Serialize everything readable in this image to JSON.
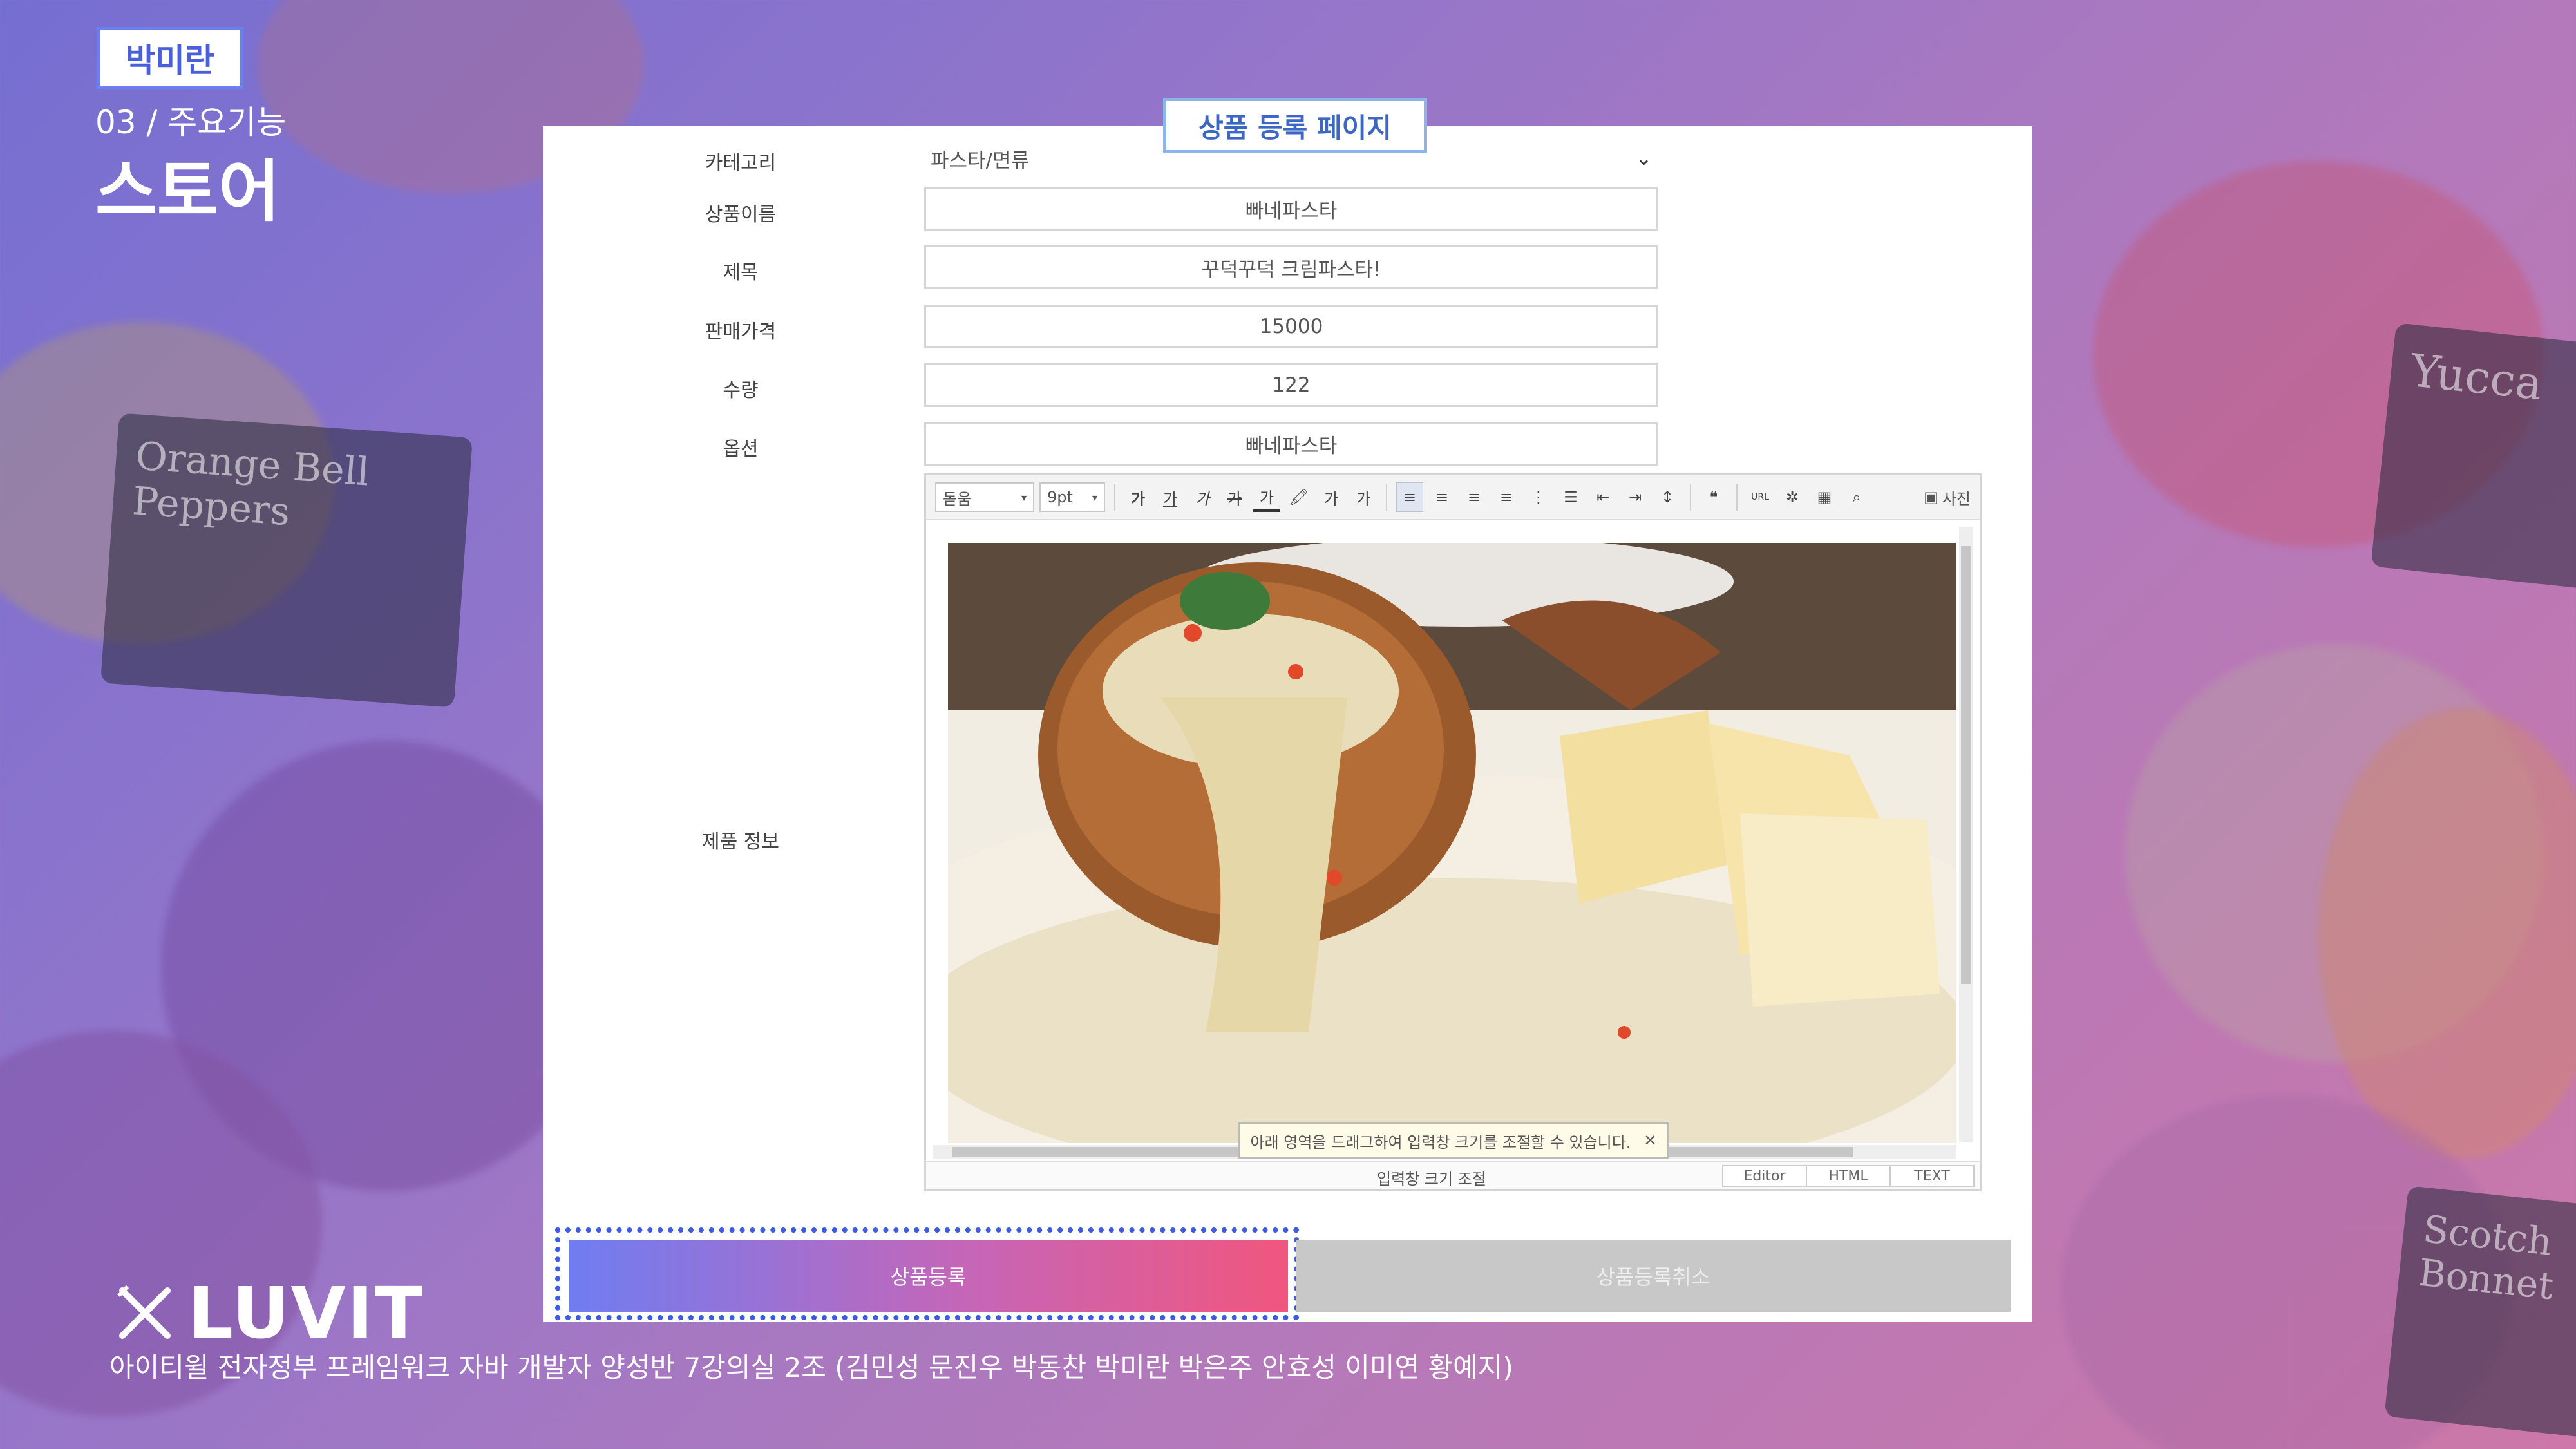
{
  "presenter": "박미란",
  "section": {
    "sub": "03 / 주요기능",
    "title": "스토어"
  },
  "page_title": "상품 등록 페이지",
  "form": {
    "category": {
      "label": "카테고리",
      "value": "파스타/면류"
    },
    "product_name": {
      "label": "상품이름",
      "value": "빠네파스타"
    },
    "subject": {
      "label": "제목",
      "value": "꾸덕꾸덕 크림파스타!"
    },
    "price": {
      "label": "판매가격",
      "value": "15000"
    },
    "quantity": {
      "label": "수량",
      "value": "122"
    },
    "option": {
      "label": "옵션",
      "value": "빠네파스타"
    },
    "info": {
      "label": "제품 정보"
    }
  },
  "editor": {
    "font": "돋움",
    "size": "9pt",
    "toolbar_buttons": [
      "가",
      "가",
      "가",
      "가",
      "가",
      "가",
      "가",
      "가"
    ],
    "photo_label": "사진",
    "tooltip": "아래 영역을 드래그하여 입력창 크기를 조절할 수 있습니다.",
    "resize_label": "입력창 크기 조절",
    "modes": [
      "Editor",
      "HTML",
      "TEXT"
    ]
  },
  "buttons": {
    "register": "상품등록",
    "cancel": "상품등록취소"
  },
  "footer": {
    "logo": "LUVIT",
    "credits": "아이티윌 전자정부 프레임워크 자바 개발자 양성반 7강의실 2조 (김민성 문진우 박동찬 박미란 박은주 안효성 이미연 황예지)"
  }
}
